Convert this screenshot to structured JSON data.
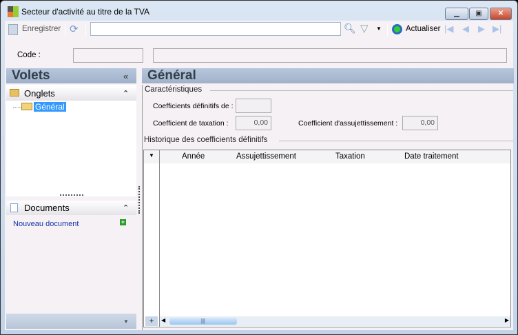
{
  "window": {
    "title": "Secteur d'activité au titre de la TVA"
  },
  "toolbar": {
    "save_label": "Enregistrer",
    "search_value": "",
    "refresh_label": "Actualiser"
  },
  "code": {
    "label": "Code :",
    "value": "",
    "description": ""
  },
  "left": {
    "title": "Volets",
    "tabs_section": "Onglets",
    "tree_item": "Général",
    "documents_section": "Documents",
    "new_document": "Nouveau document"
  },
  "main": {
    "title": "Général",
    "characteristics": "Caractéristiques",
    "coef_def_label": "Coefficients définitifs de :",
    "coef_def_value": "",
    "coef_tax_label": "Coefficient de taxation :",
    "coef_tax_value": "0,00",
    "coef_assuj_label": "Coefficient d'assujettissement :",
    "coef_assuj_value": "0,00",
    "history": "Historique des coefficients définitifs",
    "columns": [
      "Année",
      "Assujettissement",
      "Taxation",
      "Date traitement"
    ]
  }
}
